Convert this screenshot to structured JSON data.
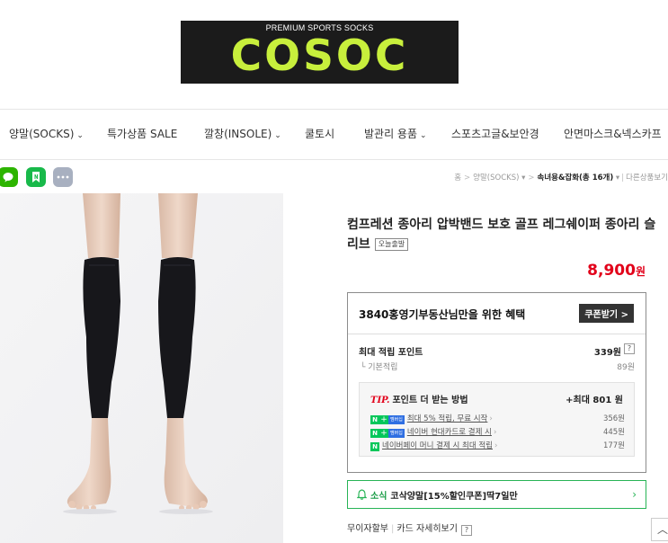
{
  "logo": {
    "tagline": "PREMIUM SPORTS SOCKS",
    "brand": "COSOC",
    "accent_color": "#c8ef3c"
  },
  "nav": {
    "items": [
      {
        "label": "양말(SOCKS)",
        "has_dropdown": true
      },
      {
        "label": "특가상품 SALE",
        "has_dropdown": false
      },
      {
        "label": "깔창(INSOLE)",
        "has_dropdown": true
      },
      {
        "label": "쿨토시",
        "has_dropdown": false
      },
      {
        "label": "발관리 용품",
        "has_dropdown": true
      },
      {
        "label": "스포츠고글&보안경",
        "has_dropdown": false
      },
      {
        "label": "안면마스크&넥스카프",
        "has_dropdown": false
      }
    ],
    "chevron": "⌄"
  },
  "share": {
    "icons": [
      "kakaotalk-icon",
      "naver-bookmark-icon",
      "more-icon"
    ]
  },
  "breadcrumb": {
    "home": "홈",
    "sep": ">",
    "category": "양말(SOCKS)",
    "current": "속녀용&잡화(총 16개)",
    "tail": "다른상품보기"
  },
  "product": {
    "title": "컴프레션 종아리 압박밴드 보호 골프 레그쉐이퍼 종아리 슬리브",
    "badge": "오늘출발",
    "price": "8,900",
    "currency": "원"
  },
  "benefit": {
    "heading": "3840홍영기부동산님만을 위한 혜택",
    "coupon_button": "쿠폰받기 >",
    "points_label": "최대 적립 포인트",
    "points_value": "339원",
    "help": "?",
    "base_label": "기본적립",
    "base_value": "89원",
    "tip_prefix": "TIP.",
    "tip_title": "포인트 더 받는 방법",
    "tip_max": "+최대 801 원",
    "tip_rows": [
      {
        "text": "최대 5% 적립, 무료 시작",
        "value": "356원"
      },
      {
        "text": "네이버 현대카드로 결제 시",
        "value": "445원"
      },
      {
        "text": "네이버페이 머니 결제 시 최대 적립",
        "value": "177원"
      }
    ],
    "membership_tag": "멤버십"
  },
  "notice": {
    "label": "소식",
    "message": "코삭양말[15%할인쿠폰]딱7일만",
    "arrow": "›"
  },
  "payment": {
    "interest_free": "무이자할부",
    "card_detail": "카드 자세히보기",
    "help": "?"
  },
  "to_top": "︿"
}
